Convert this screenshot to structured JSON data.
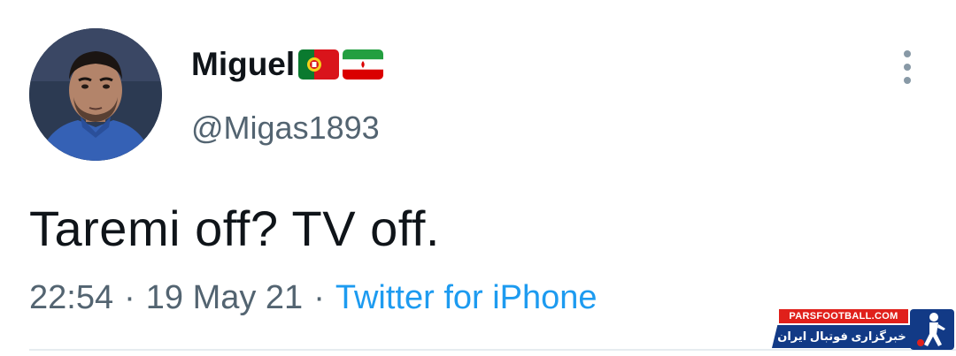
{
  "tweet": {
    "author": {
      "display_name": "Miguel",
      "handle": "@Migas1893",
      "flags": [
        "portugal-flag",
        "iran-flag"
      ]
    },
    "text": "Taremi off? TV off.",
    "time": "22:54",
    "date": "19 May 21",
    "separator": "·",
    "source": "Twitter for iPhone"
  },
  "watermark": {
    "site": "PARSFOOTBALL.COM",
    "tagline": "خبرگزاری فوتبال ایران"
  },
  "colors": {
    "link": "#1d9bf0",
    "secondary_text": "#536471",
    "watermark_red": "#e0201b",
    "watermark_blue": "#123a86"
  }
}
